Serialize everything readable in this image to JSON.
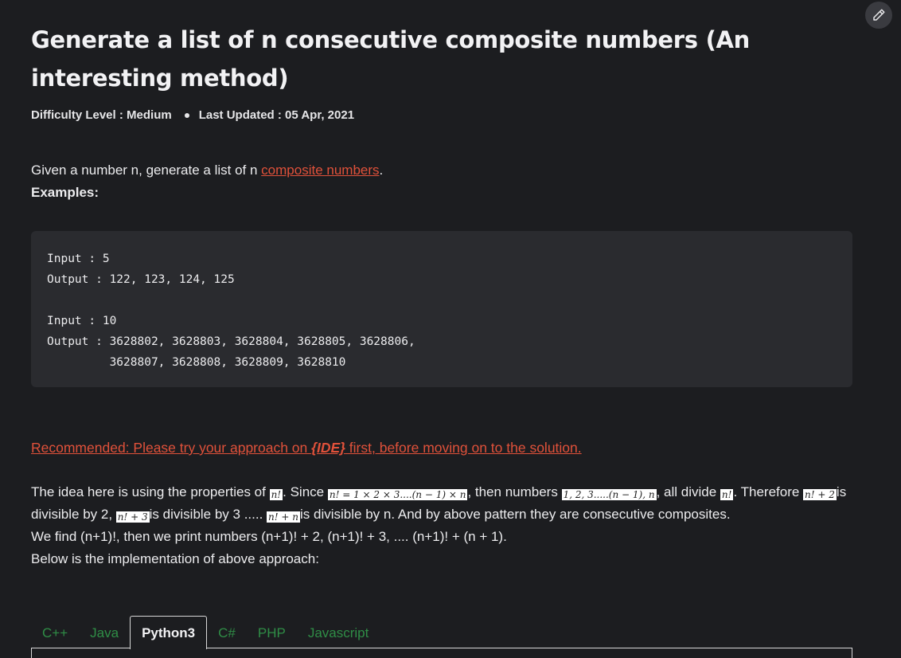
{
  "article": {
    "title": "Generate a list of n consecutive composite numbers (An interesting method)",
    "difficulty": "Difficulty Level : Medium",
    "last_updated": "Last Updated : 05 Apr, 2021",
    "intro_prefix": "Given a number n, generate a list of n ",
    "intro_link": "composite numbers",
    "intro_suffix": ".",
    "examples_label": "Examples:",
    "code_example": "Input : 5\nOutput : 122, 123, 124, 125\n\nInput : 10\nOutput : 3628802, 3628803, 3628804, 3628805, 3628806,\n         3628807, 3628808, 3628809, 3628810",
    "recommend_prefix": "Recommended: Please try your approach on ",
    "recommend_ide": "{IDE}",
    "recommend_suffix": " first, before moving on to the solution.",
    "p1_a": "The idea here is using the properties of ",
    "p1_b": ". Since ",
    "p1_c": ", then numbers ",
    "p1_d": ", all divide ",
    "p1_e": ". Therefore ",
    "p1_f": "is",
    "p1_g": "divisible by 2, ",
    "p1_h": "is divisible by 3 ..... ",
    "p1_i": "is divisible by n. And by above pattern they are consecutive composites.",
    "p2": "We find (n+1)!, then we print numbers (n+1)! + 2, (n+1)! + 3, .... (n+1)! + (n + 1).",
    "p3": "Below is the implementation of above approach:",
    "math": {
      "nfact": "n!",
      "since": "n! = 1 × 2 × 3....(n − 1) × n",
      "numbers": "1, 2, 3.....(n − 1), n",
      "nfact_plus_2": "n! + 2",
      "nfact_plus_3": "n! + 3",
      "nfact_plus_n": "n! + n"
    }
  },
  "tabs": [
    "C++",
    "Java",
    "Python3",
    "C#",
    "PHP",
    "Javascript"
  ],
  "active_tab": "Python3",
  "colors": {
    "link": "#e0513a",
    "tab": "#2f8d46",
    "background": "#1c1d20"
  },
  "icons": {
    "edit": "pencil-icon"
  }
}
